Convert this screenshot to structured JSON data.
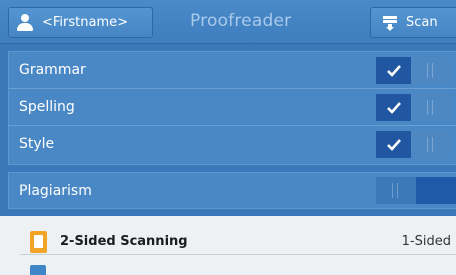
{
  "header": {
    "user_label": "<Firstname>",
    "app_title": "Proofreader",
    "scan_label": "Scan",
    "icons": {
      "user": "user-icon",
      "scan": "scanner-icon"
    }
  },
  "settings": {
    "rows": [
      {
        "label": "Grammar",
        "enabled": true
      },
      {
        "label": "Spelling",
        "enabled": true
      },
      {
        "label": "Style",
        "enabled": true
      }
    ],
    "plagiarism": {
      "label": "Plagiarism",
      "enabled": false
    }
  },
  "scan_options": {
    "name": "2-Sided Scanning",
    "value": "1-Sided",
    "icon": "document-icon"
  },
  "colors": {
    "accent": "#2156a0",
    "panel": "#4a88c5",
    "header": "#3f7ebf",
    "bottom_panel": "#eef1f4",
    "doc_icon": "#f1a428"
  }
}
